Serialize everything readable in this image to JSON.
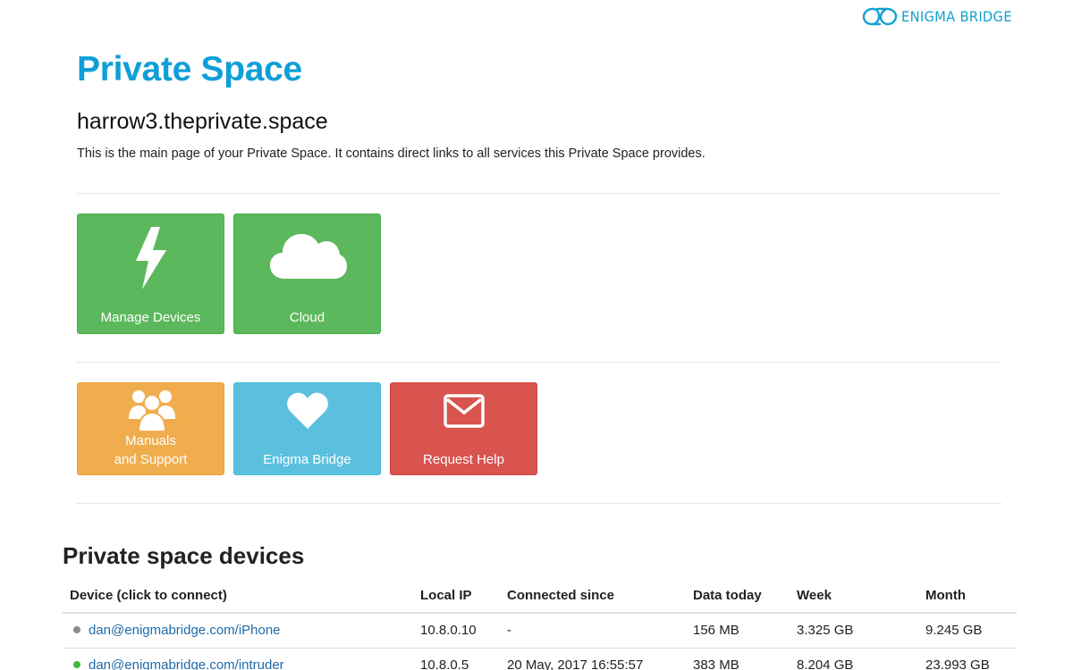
{
  "brand": {
    "name": "ENIGMA BRIDGE",
    "color": "#14a1cf"
  },
  "header": {
    "title": "Private Space",
    "hostname": "harrow3.theprivate.space",
    "intro": "This is the main page of your Private Space. It contains direct links to all services this Private Space provides."
  },
  "tiles": {
    "manage_devices": {
      "label": "Manage Devices",
      "icon": "lightning-bolt-icon",
      "color": "#5cb85c"
    },
    "cloud": {
      "label": "Cloud",
      "icon": "cloud-icon",
      "color": "#5cb85c"
    },
    "manuals": {
      "label_line1": "Manuals",
      "label_line2": "and Support",
      "icon": "users-icon",
      "color": "#f0ad4e"
    },
    "enigma_bridge": {
      "label": "Enigma Bridge",
      "icon": "heart-icon",
      "color": "#5bc0de"
    },
    "request_help": {
      "label": "Request Help",
      "icon": "envelope-icon",
      "color": "#d9534f"
    }
  },
  "devices": {
    "title": "Private space devices",
    "columns": {
      "device": "Device (click to connect)",
      "local_ip": "Local IP",
      "connected_since": "Connected since",
      "data_today": "Data today",
      "week": "Week",
      "month": "Month"
    },
    "rows": [
      {
        "status": "offline",
        "status_color": "#8a8a8a",
        "device": "dan@enigmabridge.com/iPhone",
        "local_ip": "10.8.0.10",
        "connected_since": "-",
        "data_today": "156 MB",
        "week": "3.325 GB",
        "month": "9.245 GB"
      },
      {
        "status": "online",
        "status_color": "#3cb83c",
        "device": "dan@enigmabridge.com/intruder",
        "local_ip": "10.8.0.5",
        "connected_since": "20 May, 2017 16:55:57",
        "data_today": "383 MB",
        "week": "8.204 GB",
        "month": "23.993 GB"
      }
    ]
  }
}
